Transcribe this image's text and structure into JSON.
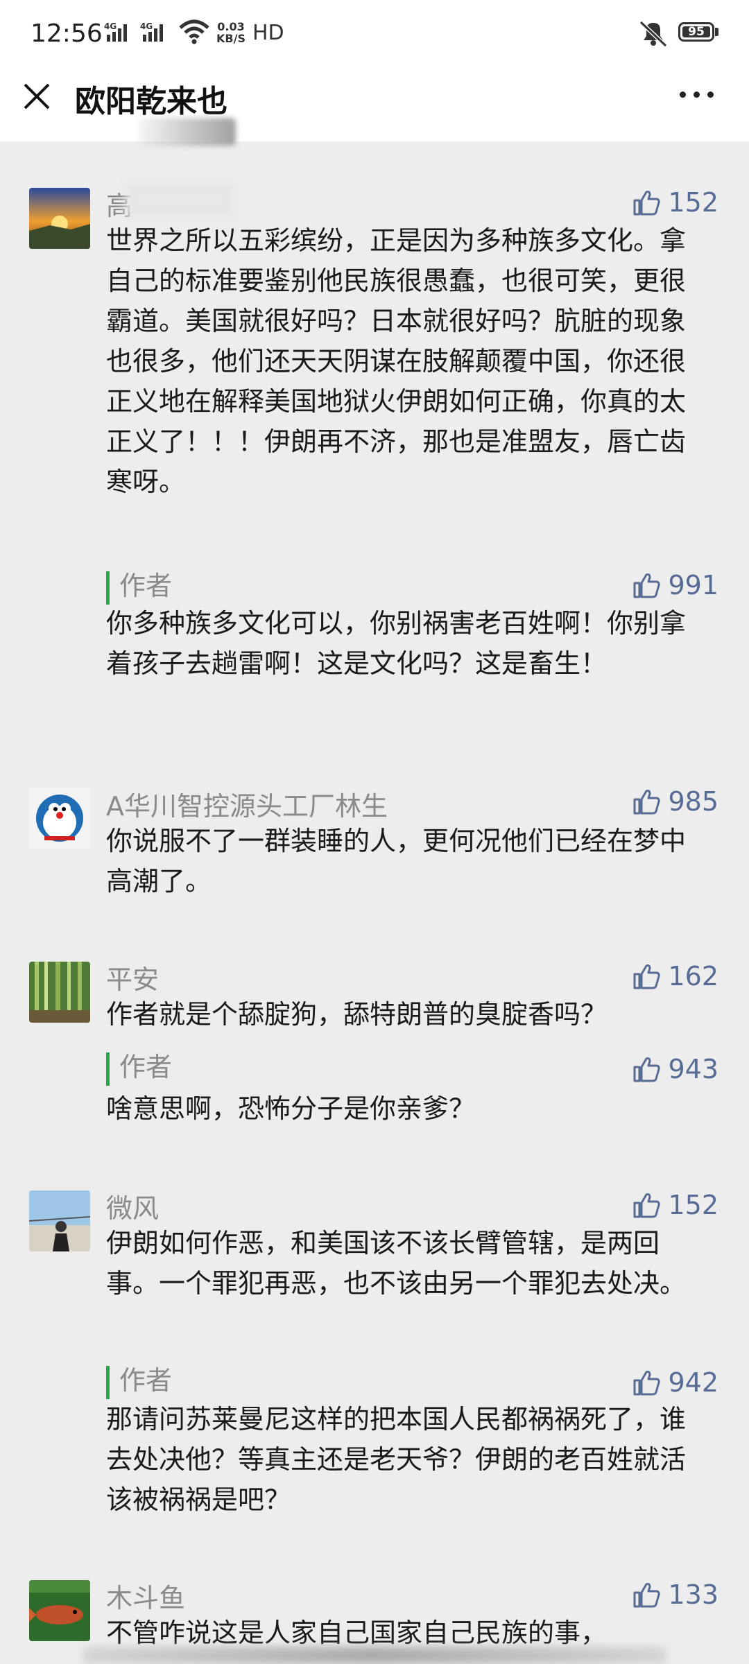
{
  "status_bar": {
    "time": "12:56",
    "network": "4G 4G",
    "speed_value": "0.03",
    "speed_unit": "KB/S",
    "hd": "HD",
    "battery": "95"
  },
  "header": {
    "title": "欧阳乾来也"
  },
  "comments": [
    {
      "name": "高",
      "likes": "152",
      "text": "世界之所以五彩缤纷，正是因为多种族多文化。拿自己的标准要鉴别他民族很愚蠢，也很可笑，更很霸道。美国就很好吗？日本就很好吗？肮脏的现象也很多，他们还天天阴谋在肢解颠覆中国，你还很正义地在解释美国地狱火伊朗如何正确，你真的太正义了！！！伊朗再不济，那也是准盟友，唇亡齿寒呀。",
      "reply": {
        "author": "作者",
        "likes": "991",
        "text": "你多种族多文化可以，你别祸害老百姓啊！你别拿着孩子去趟雷啊！这是文化吗？这是畜生！"
      }
    },
    {
      "name": "A华川智控源头工厂林生",
      "likes": "985",
      "text": "你说服不了一群装睡的人，更何况他们已经在梦中高潮了。"
    },
    {
      "name": "平安",
      "likes": "162",
      "text": "作者就是个舔腚狗，舔特朗普的臭腚香吗？",
      "reply": {
        "author": "作者",
        "likes": "943",
        "text": "啥意思啊，恐怖分子是你亲爹？"
      }
    },
    {
      "name": "微风",
      "likes": "152",
      "text": "伊朗如何作恶，和美国该不该长臂管辖，是两回事。一个罪犯再恶，也不该由另一个罪犯去处决。",
      "reply": {
        "author": "作者",
        "likes": "942",
        "text": "那请问苏莱曼尼这样的把本国人民都祸祸死了，谁去处决他？等真主还是老天爷？伊朗的老百姓就活该被祸祸是吧？"
      }
    },
    {
      "name": "木斗鱼",
      "likes": "133",
      "text": "不管咋说这是人家自己国家自己民族的事，"
    }
  ],
  "icons": {
    "like": "thumbs-up-icon",
    "close": "close-icon",
    "more": "more-dots-icon"
  },
  "colors": {
    "link_blue": "#576b95",
    "author_green": "#27a745",
    "background": "#ededed"
  }
}
